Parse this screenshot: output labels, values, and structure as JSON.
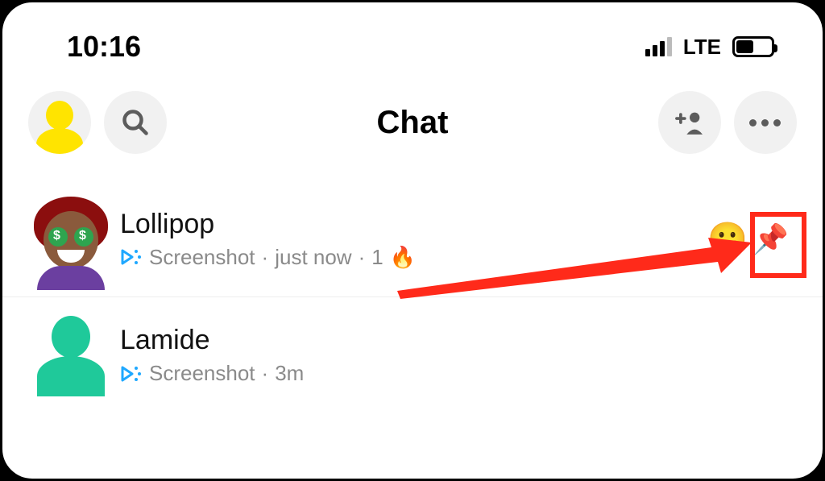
{
  "status_bar": {
    "time": "10:16",
    "network_label": "LTE"
  },
  "header": {
    "title": "Chat"
  },
  "chats": [
    {
      "name": "Lollipop",
      "status_text": "Screenshot",
      "time_text": "just now",
      "streak_count": "1",
      "streak_emoji": "🔥",
      "trailing_emoji": "😬",
      "pinned": true,
      "pin_emoji": "📌"
    },
    {
      "name": "Lamide",
      "status_text": "Screenshot",
      "time_text": "3m"
    }
  ],
  "icons": {
    "search": "search-icon",
    "add_friend": "add-friend-icon",
    "more": "more-icon",
    "screenshot": "screenshot-status-icon"
  }
}
